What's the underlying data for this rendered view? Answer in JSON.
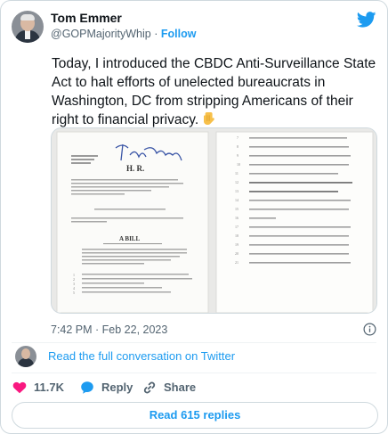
{
  "tweet": {
    "author": {
      "name": "Tom Emmer",
      "handle": "@GOPMajorityWhip",
      "separator": "·",
      "follow_label": "Follow"
    },
    "text": "Today, I introduced the CBDC Anti-Surveillance State Act to halt efforts of unelected bureaucrats in Washington, DC from stripping Americans of their right to financial privacy.",
    "text_emoji": "backhand-index-pointing-down",
    "timestamp": "7:42 PM · Feb 22, 2023",
    "full_conversation_link": "Read the full conversation on Twitter",
    "actions": {
      "likes_count": "11.7K",
      "reply_label": "Reply",
      "share_label": "Share"
    },
    "read_replies_label": "Read 615 replies"
  },
  "document": {
    "bill_number": "H. R.",
    "bill_type": "A BILL",
    "left_page_lines": [
      "To amend the Federal Reserve Act to prohibit the Federal reserve banks from offering certain products or services directly to an individual, to prohibit the use of central bank digital currency for monetary policy, and for other purposes.",
      "IN THE HOUSE OF REPRESENTATIVES",
      "A BILL"
    ],
    "right_page_lines": [
      "this Act, a Federal reserve bank may not offer products or services directly to an individual, maintain an account on behalf of an individual, or issue a central bank digital currency directly to an individual.",
      "SEC. 3. PROHIBITION ON THE USE OF CENTRAL BANK DIGITAL CURRENCY FOR MONETARY POLICY.",
      "Section 2A of the Federal Reserve Act is amended by inserting before paragraph (1) the following new paragraph:",
      "\"(1) PROHIBITION ON THE USE OF CENTRAL BANK DIGITAL CURRENCY FOR MONETARY POLICY.—The Board of Governors of the Federal Reserve System and the Federal Open Market Committee"
    ],
    "left_line_numbers": [
      "1",
      "2",
      "3",
      "4",
      "5"
    ],
    "right_line_numbers": [
      "7",
      "8",
      "9",
      "10",
      "11",
      "12",
      "13",
      "14",
      "15",
      "16",
      "17",
      "18",
      "19",
      "20",
      "21"
    ]
  },
  "colors": {
    "accent": "#1d9bf0",
    "text_primary": "#0f1419",
    "text_secondary": "#536471",
    "like_heart": "#f91880",
    "border": "#cfd9de"
  },
  "icons": [
    "twitter-bird-icon",
    "info-icon",
    "heart-icon",
    "reply-icon",
    "share-link-icon",
    "pointing-down-emoji"
  ]
}
